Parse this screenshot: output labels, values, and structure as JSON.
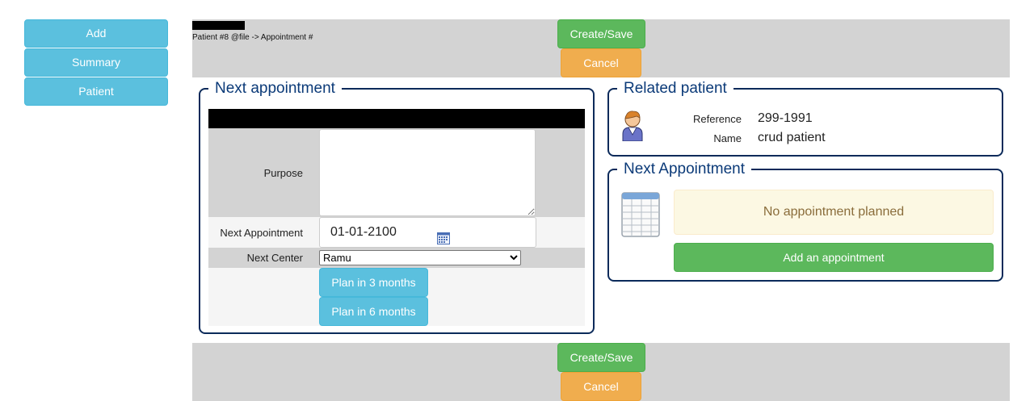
{
  "menu": {
    "add_label": "Add",
    "summary_label": "Summary",
    "patient_label": "Patient"
  },
  "header": {
    "breadcrumb": "Patient #8 @file -> Appointment #"
  },
  "actions": {
    "save_label": "Create/Save",
    "cancel_label": "Cancel"
  },
  "next_appointment_form": {
    "legend": "Next appointment",
    "purpose_label": "Purpose",
    "purpose_value": "",
    "next_appointment_label": "Next Appointment",
    "next_appointment_value": "01-01-2100",
    "next_center_label": "Next Center",
    "next_center_selected": "Ramu",
    "plan_3_label": "Plan in 3 months",
    "plan_6_label": "Plan in 6 months"
  },
  "related_patient": {
    "legend": "Related patient",
    "reference_label": "Reference",
    "reference_value": "299-1991",
    "name_label": "Name",
    "name_value": "crud patient"
  },
  "next_appointment_panel": {
    "legend": "Next Appointment",
    "notice": "No appointment planned",
    "add_label": "Add an appointment"
  },
  "colors": {
    "info": "#5bc0de",
    "success": "#5cb85c",
    "warning": "#f0ad4e",
    "bar_grey": "#d3d3d3",
    "fieldset_border": "#0b2a5a",
    "legend_text": "#0b3a78"
  },
  "icons": {
    "patient": "patient-avatar-icon",
    "calendar": "calendar-icon",
    "appointment": "spreadsheet-calendar-icon"
  }
}
